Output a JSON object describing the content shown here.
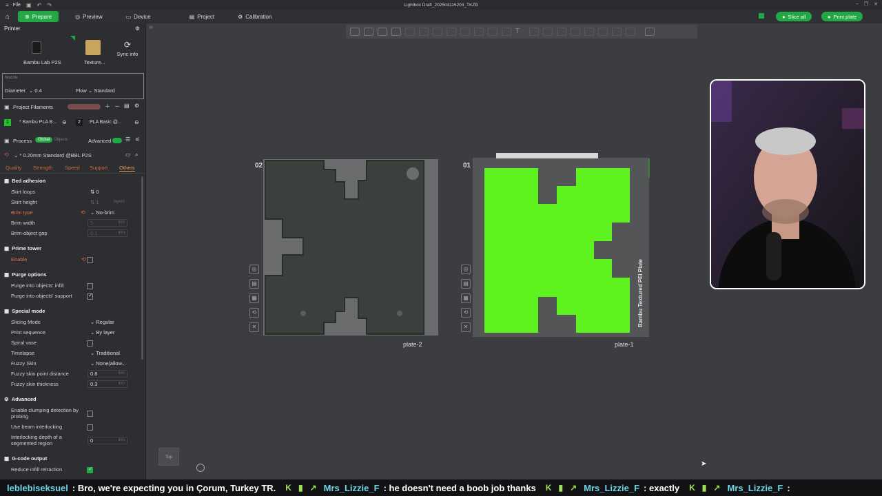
{
  "titlebar": {
    "file": "File",
    "title": "Lightbox Draft_2025041152​04_TKZB"
  },
  "tabs": [
    {
      "label": "Prepare",
      "active": true
    },
    {
      "label": "Preview"
    },
    {
      "label": "Device"
    },
    {
      "label": "Project"
    },
    {
      "label": "Calibration"
    }
  ],
  "actions": {
    "slice_all": "Slice all",
    "print_plate": "Print plate"
  },
  "printer": {
    "section": "Printer",
    "name": "Bambu Lab P2S",
    "plate": "Texture...",
    "sync": "Sync info",
    "nozzle_label": "Nozzle",
    "diameter_label": "Diameter",
    "diameter": "0.4",
    "flow_label": "Flow",
    "flow": "Standard"
  },
  "filaments": {
    "section": "Project Filaments",
    "items": [
      {
        "index": "1",
        "name": "* Bambu PLA B..."
      },
      {
        "index": "2",
        "name": "PLA Basic @..."
      }
    ]
  },
  "process": {
    "section": "Process",
    "global": "Global",
    "objects": "Objects",
    "advanced": "Advanced",
    "preset": "* 0.20mm Standard @BBL P2S",
    "subtabs": [
      "Quality",
      "Strength",
      "Speed",
      "Support",
      "Others"
    ],
    "active_subtab": "Others"
  },
  "settings": {
    "bed_adhesion": "Bed adhesion",
    "skirt_loops": {
      "label": "Skirt loops",
      "value": "0"
    },
    "skirt_height": {
      "label": "Skirt height",
      "value": "1",
      "unit": "layers"
    },
    "brim_type": {
      "label": "Brim type",
      "value": "No-brim"
    },
    "brim_width": {
      "label": "Brim width",
      "value": "5",
      "unit": "mm"
    },
    "brim_gap": {
      "label": "Brim-object gap",
      "value": "0.1",
      "unit": "mm"
    },
    "prime_tower": "Prime tower",
    "enable": {
      "label": "Enable"
    },
    "purge_options": "Purge options",
    "purge_infill": {
      "label": "Purge into objects' infill"
    },
    "purge_support": {
      "label": "Purge into objects' support"
    },
    "special_mode": "Special mode",
    "slicing_mode": {
      "label": "Slicing Mode",
      "value": "Regular"
    },
    "print_sequence": {
      "label": "Print sequence",
      "value": "By layer"
    },
    "spiral_vase": {
      "label": "Spiral vase"
    },
    "timelapse": {
      "label": "Timelapse",
      "value": "Traditional"
    },
    "fuzzy_skin": {
      "label": "Fuzzy Skin",
      "value": "None(allow..."
    },
    "fuzzy_distance": {
      "label": "Fuzzy skin point distance",
      "value": "0.8",
      "unit": "mm"
    },
    "fuzzy_thickness": {
      "label": "Fuzzy skin thickness",
      "value": "0.3",
      "unit": "mm"
    },
    "advanced": "Advanced",
    "clumping": {
      "label": "Enable clumping detection by probing"
    },
    "beam": {
      "label": "Use beam interlocking"
    },
    "interlock_depth": {
      "label": "Interlocking depth of a segmented region",
      "value": "0",
      "unit": "mm"
    },
    "gcode_output": "G-code output",
    "reduce_infill": {
      "label": "Reduce infill retraction"
    }
  },
  "viewport": {
    "plate2_num": "02",
    "plate1_num": "01",
    "plate2_label": "plate-2",
    "plate1_label": "plate-1",
    "plate1_text": "Bambu Textured PEI Plate",
    "top_label": "Top"
  },
  "ticker": [
    {
      "user": "leblebiseksuel",
      "msg": ": Bro, we're expecting you in Çorum, Turkey TR."
    },
    {
      "user": "Mrs_Lizzie_F",
      "msg": ": he doesn't need a boob job thanks"
    },
    {
      "user": "Mrs_Lizzie_F",
      "msg": ": exactly"
    },
    {
      "user": "Mrs_Lizzie_F",
      "msg": ":"
    }
  ],
  "colors": {
    "accent": "#22a845",
    "model_green": "#5ef21f",
    "dark_model": "#3c403c"
  }
}
